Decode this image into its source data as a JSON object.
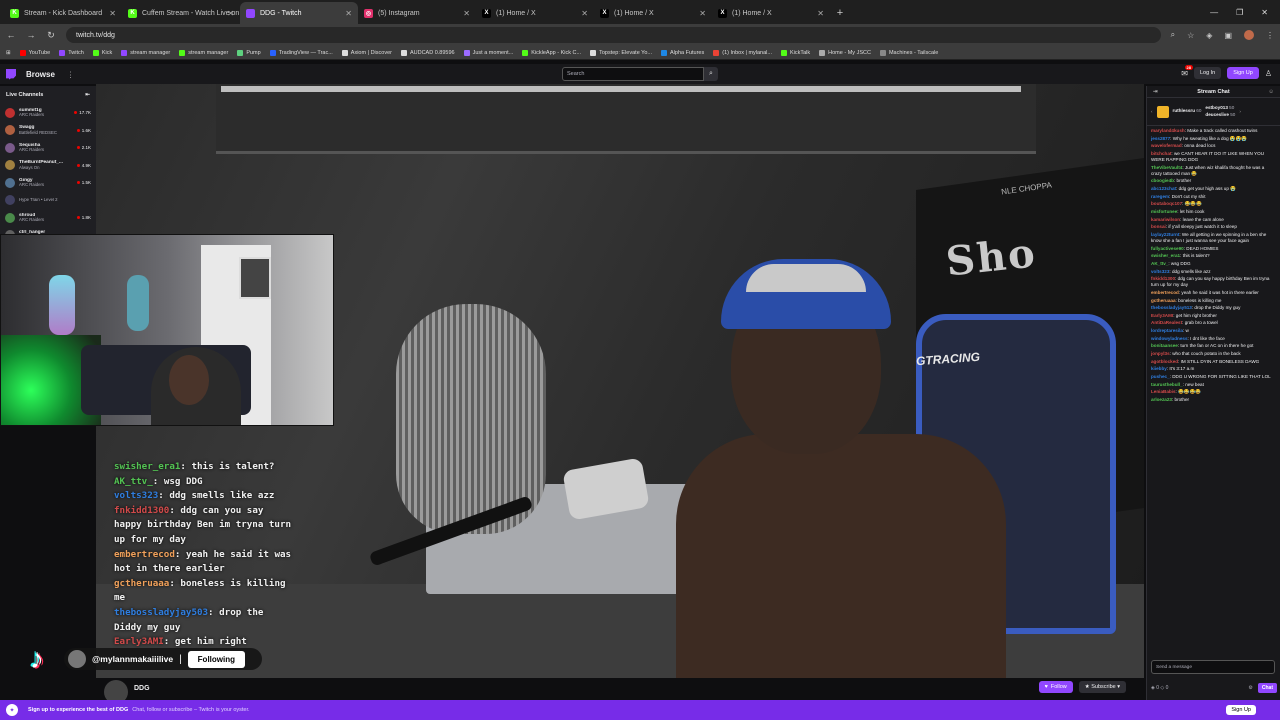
{
  "browser": {
    "tabs": [
      {
        "label": "Stream - Kick Dashboard",
        "fav": "K",
        "color": "#53fc18",
        "active": false
      },
      {
        "label": "Cuffem Stream - Watch Live on Kick",
        "fav": "K",
        "color": "#53fc18",
        "active": false
      },
      {
        "label": "DDG - Twitch",
        "fav": "",
        "color": "#9147ff",
        "active": true
      },
      {
        "label": "(5) Instagram",
        "fav": "◎",
        "color": "#e1306c",
        "active": false
      },
      {
        "label": "(1) Home / X",
        "fav": "X",
        "color": "#000000",
        "active": false
      },
      {
        "label": "(1) Home / X",
        "fav": "X",
        "color": "#000000",
        "active": false
      },
      {
        "label": "(1) Home / X",
        "fav": "X",
        "color": "#000000",
        "active": false
      }
    ],
    "url": "twitch.tv/ddg",
    "bookmarks": [
      {
        "label": "YouTube",
        "color": "#ff0000"
      },
      {
        "label": "Twitch",
        "color": "#9147ff"
      },
      {
        "label": "Kick",
        "color": "#53fc18"
      },
      {
        "label": "stream manager",
        "color": "#9147ff"
      },
      {
        "label": "stream manager",
        "color": "#53fc18"
      },
      {
        "label": "Pump",
        "color": "#5ed17f"
      },
      {
        "label": "TradingView — Trac...",
        "color": "#2962ff"
      },
      {
        "label": "Axiom | Discover",
        "color": "#dddddd"
      },
      {
        "label": "AUDCAD 0.89596",
        "color": "#dddddd"
      },
      {
        "label": "Just a moment...",
        "color": "#9b6bff"
      },
      {
        "label": "KickleApp - Kick C...",
        "color": "#53fc18"
      },
      {
        "label": "Topstep: Elevate Yo...",
        "color": "#dddddd"
      },
      {
        "label": "Alpha Futures",
        "color": "#1e88e5"
      },
      {
        "label": "(1) Inbox | mylanal...",
        "color": "#ea4335"
      },
      {
        "label": "KickTalk",
        "color": "#53fc18"
      },
      {
        "label": "Home - My JSCC",
        "color": "#aaaaaa"
      },
      {
        "label": "Machines - Tailscale",
        "color": "#888888"
      }
    ]
  },
  "nav": {
    "browse": "Browse",
    "search_placeholder": "Search",
    "notif_count": "28",
    "login": "Log In",
    "signup": "Sign Up"
  },
  "sidebar": {
    "title": "Live Channels",
    "channels": [
      {
        "name": "summit1g",
        "game": "ARC Raiders",
        "viewers": "17.7K",
        "color": "#c03030"
      },
      {
        "name": "Swagg",
        "game": "Battlefield REDSEC",
        "viewers": "1.6K",
        "color": "#b06040"
      },
      {
        "name": "Sequisha",
        "game": "ARC Raiders",
        "viewers": "2.1K",
        "color": "#7a5a8a"
      },
      {
        "name": "TheBurntPeanut_...",
        "game": "Always On",
        "viewers": "4.9K",
        "color": "#a08040"
      },
      {
        "name": "Gingy",
        "game": "ARC Raiders",
        "viewers": "1.5K",
        "color": "#507090"
      },
      {
        "name": "",
        "game": "Hype Train • Level 2",
        "viewers": "",
        "color": "#404060"
      },
      {
        "name": "shroud",
        "game": "ARC Raiders",
        "viewers": "1.8K",
        "color": "#4a8a4a"
      },
      {
        "name": "ctrl_hanger",
        "game": "The TV Show",
        "viewers": "8",
        "color": "#606060"
      }
    ]
  },
  "video": {
    "poster_text": "Sho",
    "poster_label": "NLE CHOPPA",
    "chair_label": "GTRACING",
    "overlay_chat": [
      {
        "user": "swisher_era1",
        "text": "this is talent?",
        "cls": "u"
      },
      {
        "user": "AK_ttv_",
        "text": "wsg DDG",
        "cls": "u"
      },
      {
        "user": "volts323",
        "text": "ddg smells like azz",
        "cls": "u2"
      },
      {
        "user": "fnkidd1300",
        "text": "ddg can you say happy birthday Ben im tryna turn up for my day",
        "cls": "u4"
      },
      {
        "user": "embertrecod",
        "text": "yeah he said it was hot in there earlier",
        "cls": "u3"
      },
      {
        "user": "gctheruaaa",
        "text": "boneless is killing me",
        "cls": "u3"
      },
      {
        "user": "thebossladyjay503",
        "text": "drop the Diddy my guy",
        "cls": "u2"
      },
      {
        "user": "Early3AMI",
        "text": "get him right",
        "cls": "u4"
      }
    ]
  },
  "tiktok": {
    "handle": "@mylannmakaiiilive",
    "separator": "|",
    "follow": "Following"
  },
  "channel": {
    "name": "DDG",
    "follow": "Follow",
    "subscribe": "Subscribe"
  },
  "bottom": {
    "title": "Sign up to experience the best of DDG",
    "subtitle": "Chat, follow or subscribe – Twitch is your oyster.",
    "signup": "Sign Up"
  },
  "chat": {
    "title": "Stream Chat",
    "pinned": [
      {
        "user": "ruthlessru",
        "amount": "60"
      },
      {
        "user": "estboy013",
        "amount": "50"
      },
      {
        "user": "deuceslive",
        "amount": "50"
      }
    ],
    "messages": [
      {
        "user": "maryland4kush",
        "text": "Make a track called crashout twins",
        "color": "#d24a4a"
      },
      {
        "user": "jess2877",
        "text": "Why he sweating like a dog 😭😭😭",
        "color": "#2f7ee0"
      },
      {
        "user": "wavelofermad",
        "text": "onna dead locs",
        "color": "#d24a4a"
      },
      {
        "user": "bitchchat",
        "text": "we CANT HEAR IT DO IT LIKE WHEN YOU WERE RAPPING DDG",
        "color": "#d24a4a"
      },
      {
        "user": "TheVibeVault4",
        "text": "Just when wiz khalifa thought he was a crazy tattooed man 😂",
        "color": "#53c353"
      },
      {
        "user": "cboogie4b",
        "text": "brother",
        "color": "#53c353"
      },
      {
        "user": "abc123chat",
        "text": "ddg get your high ass up 😭",
        "color": "#2f7ee0"
      },
      {
        "user": "raregem",
        "text": "Don't cut my shit",
        "color": "#2f7ee0"
      },
      {
        "user": "boutaboqc107",
        "text": "😂😂😂",
        "color": "#d24a4a"
      },
      {
        "user": "misfortunee",
        "text": "let him cook",
        "color": "#53c353"
      },
      {
        "user": "kamariwilson",
        "text": "leave the cam alone",
        "color": "#d24a4a"
      },
      {
        "user": "bonsai",
        "text": "if y'all sleepy just watch it to sleep",
        "color": "#d24a4a"
      },
      {
        "user": "laylay22turnt",
        "text": "We all getting in we spinning in a ben she know she a fan I just wanna see your face again",
        "color": "#2f7ee0"
      },
      {
        "user": "fullyactivese90",
        "text": "DEAD HOMIES",
        "color": "#53c353"
      },
      {
        "user": "swisher_era1",
        "text": "this is talent?",
        "color": "#53c353"
      },
      {
        "user": "AK_ttv_",
        "text": "wsg DDG",
        "color": "#53c353"
      },
      {
        "user": "volts323",
        "text": "ddg smells like azz",
        "color": "#2f7ee0"
      },
      {
        "user": "fnkidd1300",
        "text": "ddg can you say happy birthday Ben im tryna turn up for my day",
        "color": "#d24a4a"
      },
      {
        "user": "embertrecod",
        "text": "yeah he said it was hot in there earlier",
        "color": "#f0a05a"
      },
      {
        "user": "gctheruaaa",
        "text": "boneless is killing me",
        "color": "#f0a05a"
      },
      {
        "user": "thebossladyjay513",
        "text": "drop the Diddy my guy",
        "color": "#2f7ee0"
      },
      {
        "user": "Early3AMI",
        "text": "get him right brother",
        "color": "#d24a4a"
      },
      {
        "user": "AntiDaRealest",
        "text": "grab bro a towel",
        "color": "#d24a4a"
      },
      {
        "user": "lordreptaresila",
        "text": "w",
        "color": "#2f7ee0"
      },
      {
        "user": "windowyladness",
        "text": "I dnt like the face",
        "color": "#2f7ee0"
      },
      {
        "user": "bonitaansee",
        "text": "turn the fan or AC on in there he got",
        "color": "#53c353"
      },
      {
        "user": "jonpyl3s",
        "text": "who that couch potato in the back",
        "color": "#d24a4a"
      },
      {
        "user": "agotblocked",
        "text": "IM STILL DYIN AT BONELESS DAWG",
        "color": "#d24a4a"
      },
      {
        "user": "kiiebby",
        "text": "It's 3:17 a.m",
        "color": "#2f7ee0"
      },
      {
        "user": "pushec_",
        "text": "DDG U WRONG FOR SITTING LIKE THAT LOL",
        "color": "#2f7ee0"
      },
      {
        "user": "taurusthebull_",
        "text": "new beat",
        "color": "#53c353"
      },
      {
        "user": "LeniaBabis",
        "text": "😂😂😂😂",
        "color": "#d24a4a"
      },
      {
        "user": "arloeza23",
        "text": "brother",
        "color": "#53c353"
      }
    ],
    "input_placeholder": "Send a message",
    "points": "0",
    "bits": "0",
    "chat_btn": "Chat"
  }
}
